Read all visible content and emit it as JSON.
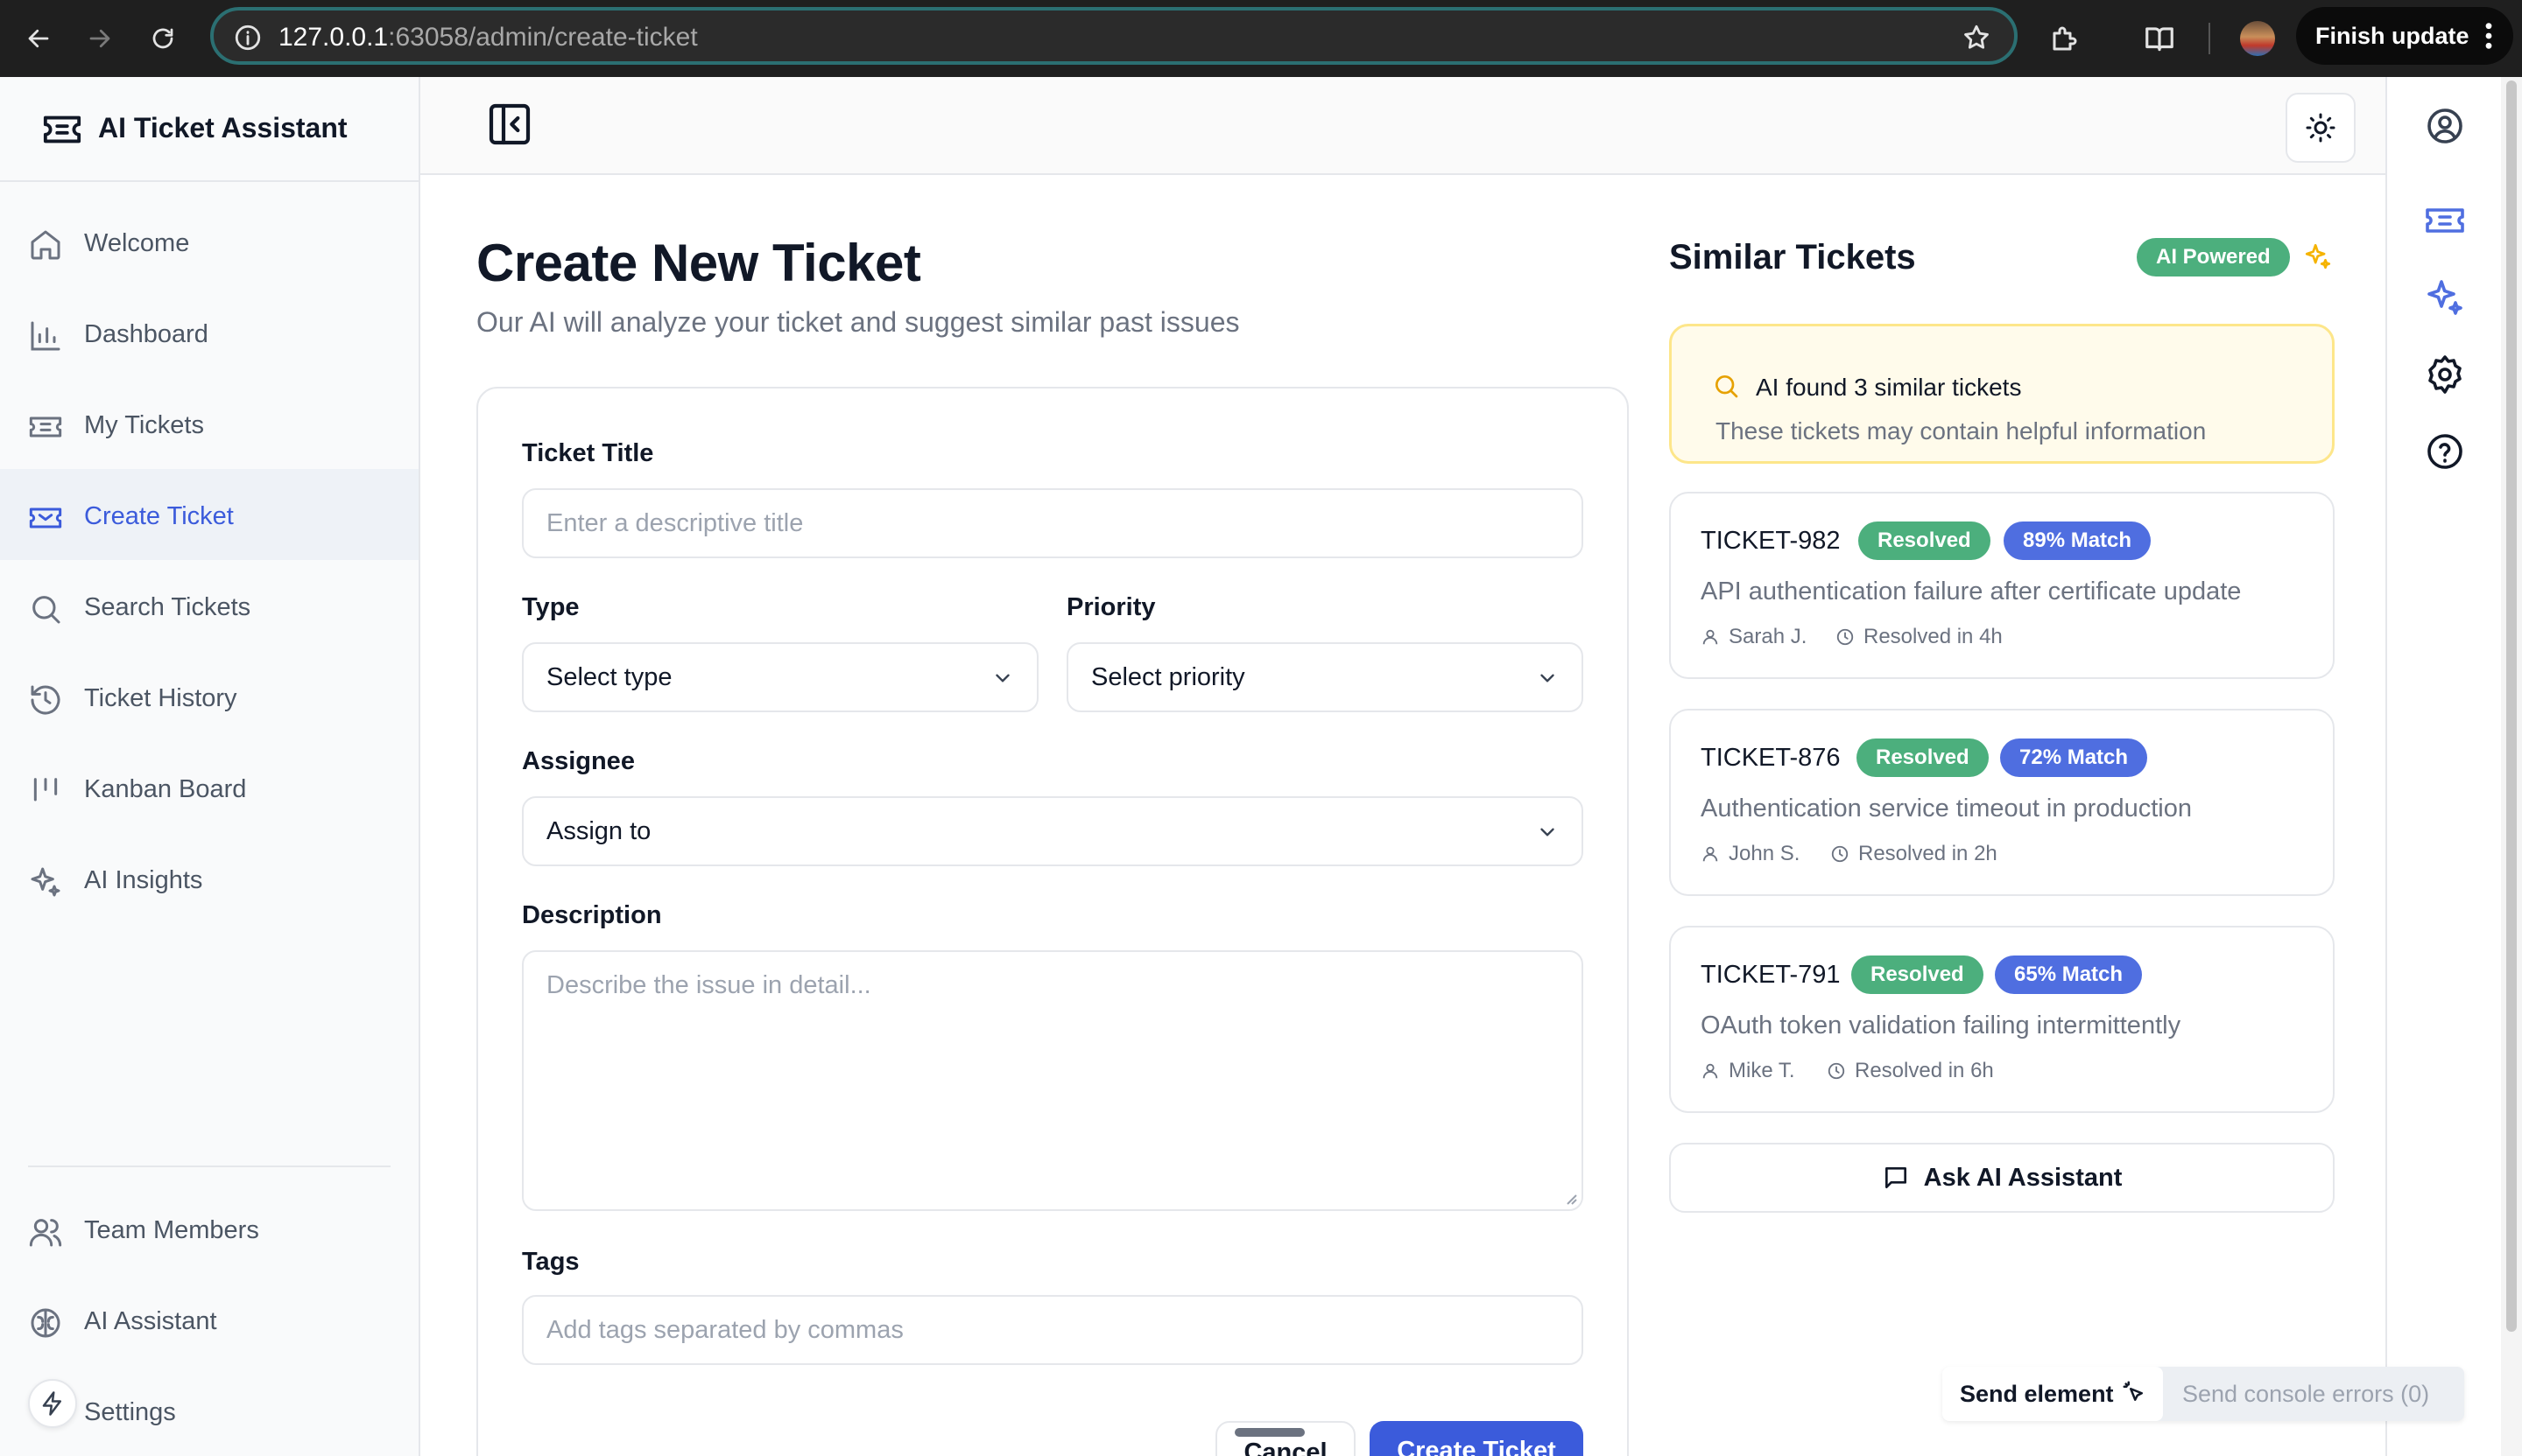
{
  "browser": {
    "url_host": "127.0.0.1",
    "url_rest": ":63058/admin/create-ticket",
    "finish_update_label": "Finish update"
  },
  "sidebar": {
    "brand": "AI Ticket Assistant",
    "items": [
      {
        "label": "Welcome",
        "icon": "home-icon"
      },
      {
        "label": "Dashboard",
        "icon": "bar-chart-icon"
      },
      {
        "label": "My Tickets",
        "icon": "ticket-icon"
      },
      {
        "label": "Create Ticket",
        "icon": "ticket-edit-icon",
        "active": true
      },
      {
        "label": "Search Tickets",
        "icon": "search-icon"
      },
      {
        "label": "Ticket History",
        "icon": "history-icon"
      },
      {
        "label": "Kanban Board",
        "icon": "kanban-icon"
      },
      {
        "label": "AI Insights",
        "icon": "sparkles-icon"
      }
    ],
    "bottom_items": [
      {
        "label": "Team Members",
        "icon": "users-icon"
      },
      {
        "label": "AI Assistant",
        "icon": "brain-icon"
      },
      {
        "label": "Settings",
        "icon": "settings-icon"
      }
    ]
  },
  "main": {
    "title": "Create New Ticket",
    "subtitle": "Our AI will analyze your ticket and suggest similar past issues",
    "form": {
      "title_label": "Ticket Title",
      "title_placeholder": "Enter a descriptive title",
      "type_label": "Type",
      "type_value": "Select type",
      "priority_label": "Priority",
      "priority_value": "Select priority",
      "assignee_label": "Assignee",
      "assignee_value": "Assign to",
      "description_label": "Description",
      "description_placeholder": "Describe the issue in detail...",
      "tags_label": "Tags",
      "tags_placeholder": "Add tags separated by commas",
      "cancel_label": "Cancel",
      "create_label": "Create Ticket"
    }
  },
  "similar": {
    "title": "Similar Tickets",
    "badge": "AI Powered",
    "found_title": "AI found 3 similar tickets",
    "found_subtitle": "These tickets may contain helpful information",
    "tickets": [
      {
        "id": "TICKET-982",
        "status": "Resolved",
        "match": "89% Match",
        "desc": "API authentication failure after certificate update",
        "person": "Sarah J.",
        "resolved": "Resolved in 4h"
      },
      {
        "id": "TICKET-876",
        "status": "Resolved",
        "match": "72% Match",
        "desc": "Authentication service timeout in production",
        "person": "John S.",
        "resolved": "Resolved in 2h"
      },
      {
        "id": "TICKET-791",
        "status": "Resolved",
        "match": "65% Match",
        "desc": "OAuth token validation failing intermittently",
        "person": "Mike T.",
        "resolved": "Resolved in 6h"
      }
    ],
    "ask_label": "Ask AI Assistant"
  },
  "devbar": {
    "send_element": "Send element",
    "send_console": "Send console errors (0)"
  },
  "colors": {
    "accent": "#3b5bdb",
    "resolved": "#4caf7d",
    "match": "#4f6ee0",
    "highlight_border": "#fde68a"
  }
}
